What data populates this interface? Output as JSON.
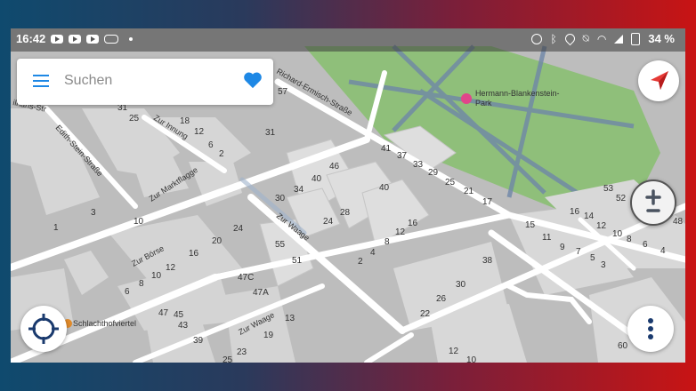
{
  "statusbar": {
    "time": "16:42",
    "battery": "34 %",
    "left_icons": [
      "youtube-icon",
      "youtube-icon",
      "youtube-icon",
      "media-icon",
      "dot-icon"
    ],
    "right_icons": [
      "alarm-icon",
      "bluetooth-icon",
      "location-icon",
      "mute-icon",
      "wifi-icon",
      "signal-icon",
      "battery-icon"
    ]
  },
  "search": {
    "placeholder": "Suchen"
  },
  "colors": {
    "accent": "#1e88e5",
    "park": "#8fbf7a",
    "road": "#ffffff",
    "ground": "#bdbdbd",
    "building": "#d8d8d8"
  },
  "map": {
    "poi": {
      "name_line1": "Hermann-Blankenstein-",
      "name_line2": "Park",
      "icon": "park-poi-icon"
    },
    "district": "Schlachthofviertel",
    "streets": {
      "ermisch": "Richard-Ermisch-Straße",
      "edith": "Edith-Stein-Straße",
      "innung": "Zur Innung",
      "marktflagge": "Zur Marktflagge",
      "waage1": "Zur Waage",
      "boerse": "Zur Börse",
      "waage2": "Zur Waage",
      "ihans": "ilhans-Str"
    },
    "house_numbers": [
      "57",
      "31",
      "25",
      "18",
      "12",
      "6",
      "2",
      "31",
      "3",
      "10",
      "1",
      "41",
      "37",
      "33",
      "29",
      "25",
      "21",
      "17",
      "46",
      "40",
      "34",
      "30",
      "40",
      "28",
      "24",
      "16",
      "12",
      "8",
      "4",
      "2",
      "55",
      "51",
      "24",
      "20",
      "16",
      "12",
      "10",
      "8",
      "6",
      "47C",
      "47A",
      "47",
      "45",
      "43",
      "39",
      "13",
      "19",
      "25",
      "23",
      "38",
      "30",
      "26",
      "22",
      "12",
      "10",
      "15",
      "11",
      "9",
      "7",
      "5",
      "3",
      "53",
      "52",
      "16",
      "14",
      "12",
      "10",
      "8",
      "6",
      "4",
      "48",
      "60"
    ]
  }
}
